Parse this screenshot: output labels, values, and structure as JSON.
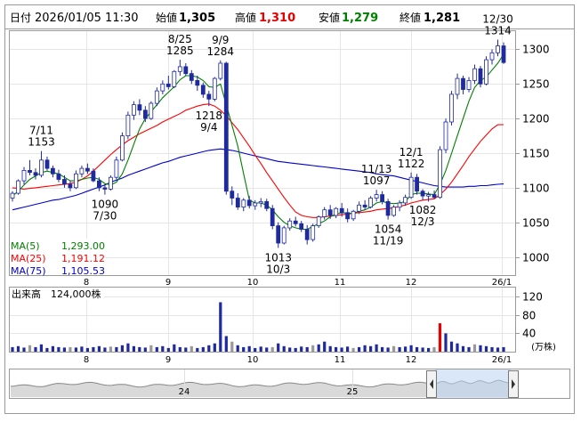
{
  "header": {
    "date_label": "日付",
    "date_value": "2026/01/05 11:30",
    "open_label": "始値",
    "open_value": "1,305",
    "high_label": "高値",
    "high_value": "1,310",
    "low_label": "安値",
    "low_value": "1,279",
    "close_label": "終値",
    "close_value": "1,281",
    "colors": {
      "high": "#e60000",
      "low": "#008000",
      "text": "#000000"
    }
  },
  "chart_data": [
    {
      "type": "candlestick",
      "y_ticks": [
        1000,
        1050,
        1100,
        1150,
        1200,
        1250,
        1300
      ],
      "x_ticks": [
        "8",
        "9",
        "10",
        "11",
        "12",
        "26/1"
      ],
      "ylim": [
        975,
        1325
      ],
      "colors": {
        "up_body": "#ffffff",
        "down_body": "#1f2a9e",
        "outline": "#1f2a9e",
        "ma5": "#008000",
        "ma25": "#ff0000",
        "ma75": "#0000cc"
      },
      "legend": [
        {
          "name": "MA(5)",
          "value": "1,293.00",
          "color": "#008000"
        },
        {
          "name": "MA(25)",
          "value": "1,191.12",
          "color": "#ff0000"
        },
        {
          "name": "MA(75)",
          "value": "1,105.53",
          "color": "#0000cc"
        }
      ],
      "annotations": [
        {
          "date": "7/11",
          "value": "1153",
          "anchor": "above"
        },
        {
          "date": "8/25",
          "value": "1285",
          "anchor": "above"
        },
        {
          "date": "9/9",
          "value": "1284",
          "anchor": "above"
        },
        {
          "date": "9/4",
          "value": "1218",
          "anchor": "below"
        },
        {
          "date": "7/30",
          "value": "1090",
          "anchor": "below"
        },
        {
          "date": "10/3",
          "value": "1013",
          "anchor": "below"
        },
        {
          "date": "11/13",
          "value": "1097",
          "anchor": "above"
        },
        {
          "date": "11/19",
          "value": "1054",
          "anchor": "below"
        },
        {
          "date": "12/1",
          "value": "1122",
          "anchor": "above"
        },
        {
          "date": "12/3",
          "value": "1082",
          "anchor": "below"
        },
        {
          "date": "12/30",
          "value": "1314",
          "anchor": "above"
        }
      ],
      "candles": [
        [
          1085,
          1095,
          1080,
          1092
        ],
        [
          1092,
          1112,
          1090,
          1110
        ],
        [
          1110,
          1130,
          1105,
          1125
        ],
        [
          1125,
          1140,
          1118,
          1122
        ],
        [
          1122,
          1128,
          1112,
          1118
        ],
        [
          1118,
          1153,
          1115,
          1140
        ],
        [
          1140,
          1145,
          1125,
          1128
        ],
        [
          1128,
          1132,
          1115,
          1120
        ],
        [
          1120,
          1126,
          1108,
          1112
        ],
        [
          1112,
          1118,
          1100,
          1105
        ],
        [
          1105,
          1110,
          1095,
          1100
        ],
        [
          1100,
          1125,
          1098,
          1120
        ],
        [
          1120,
          1132,
          1115,
          1128
        ],
        [
          1128,
          1135,
          1120,
          1124
        ],
        [
          1124,
          1128,
          1108,
          1110
        ],
        [
          1110,
          1115,
          1095,
          1100
        ],
        [
          1100,
          1105,
          1090,
          1098
        ],
        [
          1098,
          1118,
          1096,
          1115
        ],
        [
          1115,
          1145,
          1112,
          1140
        ],
        [
          1140,
          1180,
          1138,
          1175
        ],
        [
          1175,
          1210,
          1170,
          1205
        ],
        [
          1205,
          1225,
          1198,
          1220
        ],
        [
          1220,
          1228,
          1205,
          1212
        ],
        [
          1212,
          1218,
          1195,
          1200
        ],
        [
          1200,
          1225,
          1198,
          1222
        ],
        [
          1222,
          1245,
          1218,
          1240
        ],
        [
          1240,
          1255,
          1235,
          1250
        ],
        [
          1250,
          1262,
          1242,
          1246
        ],
        [
          1246,
          1270,
          1244,
          1268
        ],
        [
          1268,
          1285,
          1262,
          1275
        ],
        [
          1275,
          1280,
          1262,
          1265
        ],
        [
          1265,
          1270,
          1250,
          1255
        ],
        [
          1255,
          1262,
          1240,
          1248
        ],
        [
          1248,
          1252,
          1230,
          1235
        ],
        [
          1235,
          1240,
          1218,
          1228
        ],
        [
          1228,
          1260,
          1225,
          1258
        ],
        [
          1258,
          1284,
          1255,
          1280
        ],
        [
          1280,
          1282,
          1090,
          1095
        ],
        [
          1095,
          1102,
          1075,
          1085
        ],
        [
          1085,
          1092,
          1068,
          1072
        ],
        [
          1072,
          1085,
          1066,
          1082
        ],
        [
          1082,
          1088,
          1070,
          1074
        ],
        [
          1074,
          1082,
          1068,
          1078
        ],
        [
          1078,
          1085,
          1072,
          1080
        ],
        [
          1080,
          1084,
          1066,
          1070
        ],
        [
          1070,
          1075,
          1040,
          1045
        ],
        [
          1045,
          1050,
          1013,
          1020
        ],
        [
          1020,
          1045,
          1018,
          1042
        ],
        [
          1042,
          1056,
          1038,
          1052
        ],
        [
          1052,
          1058,
          1044,
          1048
        ],
        [
          1048,
          1052,
          1036,
          1040
        ],
        [
          1040,
          1046,
          1018,
          1025
        ],
        [
          1025,
          1048,
          1022,
          1045
        ],
        [
          1045,
          1060,
          1042,
          1058
        ],
        [
          1058,
          1072,
          1054,
          1068
        ],
        [
          1068,
          1075,
          1055,
          1060
        ],
        [
          1060,
          1072,
          1056,
          1070
        ],
        [
          1070,
          1078,
          1058,
          1064
        ],
        [
          1064,
          1070,
          1050,
          1055
        ],
        [
          1055,
          1068,
          1052,
          1066
        ],
        [
          1066,
          1080,
          1062,
          1075
        ],
        [
          1075,
          1082,
          1068,
          1072
        ],
        [
          1072,
          1088,
          1070,
          1085
        ],
        [
          1085,
          1097,
          1080,
          1090
        ],
        [
          1090,
          1095,
          1076,
          1080
        ],
        [
          1080,
          1084,
          1054,
          1060
        ],
        [
          1060,
          1075,
          1058,
          1072
        ],
        [
          1072,
          1082,
          1066,
          1078
        ],
        [
          1078,
          1090,
          1074,
          1086
        ],
        [
          1086,
          1122,
          1084,
          1115
        ],
        [
          1115,
          1120,
          1090,
          1095
        ],
        [
          1095,
          1098,
          1082,
          1088
        ],
        [
          1088,
          1094,
          1080,
          1090
        ],
        [
          1090,
          1096,
          1084,
          1086
        ],
        [
          1086,
          1160,
          1084,
          1155
        ],
        [
          1155,
          1200,
          1150,
          1195
        ],
        [
          1195,
          1240,
          1190,
          1235
        ],
        [
          1235,
          1265,
          1228,
          1258
        ],
        [
          1258,
          1262,
          1235,
          1242
        ],
        [
          1242,
          1260,
          1238,
          1255
        ],
        [
          1255,
          1278,
          1250,
          1272
        ],
        [
          1272,
          1276,
          1245,
          1250
        ],
        [
          1250,
          1290,
          1248,
          1285
        ],
        [
          1285,
          1300,
          1278,
          1295
        ],
        [
          1295,
          1314,
          1290,
          1305
        ],
        [
          1305,
          1310,
          1279,
          1281
        ]
      ],
      "ma5": [
        1088,
        1095,
        1104,
        1112,
        1117,
        1122,
        1124,
        1122,
        1120,
        1115,
        1110,
        1110,
        1112,
        1114,
        1115,
        1112,
        1106,
        1104,
        1108,
        1120,
        1140,
        1163,
        1185,
        1200,
        1210,
        1220,
        1230,
        1238,
        1246,
        1256,
        1262,
        1262,
        1260,
        1255,
        1246,
        1245,
        1250,
        1220,
        1190,
        1160,
        1120,
        1082,
        1078,
        1078,
        1075,
        1068,
        1058,
        1050,
        1045,
        1042,
        1040,
        1040,
        1044,
        1048,
        1052,
        1058,
        1062,
        1064,
        1063,
        1063,
        1066,
        1068,
        1072,
        1078,
        1080,
        1078,
        1077,
        1078,
        1080,
        1090,
        1092,
        1092,
        1091,
        1090,
        1105,
        1125,
        1150,
        1175,
        1200,
        1225,
        1245,
        1255,
        1260,
        1270,
        1280,
        1293
      ],
      "ma25": [
        1100,
        1099,
        1098,
        1099,
        1100,
        1101,
        1102,
        1103,
        1104,
        1105,
        1106,
        1108,
        1112,
        1117,
        1124,
        1132,
        1140,
        1148,
        1155,
        1162,
        1168,
        1173,
        1178,
        1182,
        1186,
        1190,
        1195,
        1199,
        1203,
        1207,
        1212,
        1215,
        1218,
        1220,
        1221,
        1218,
        1212,
        1204,
        1194,
        1184,
        1172,
        1160,
        1147,
        1135,
        1122,
        1110,
        1098,
        1086,
        1075,
        1065,
        1060,
        1058,
        1057,
        1057,
        1058,
        1059,
        1060,
        1061,
        1062,
        1063,
        1064,
        1065,
        1066,
        1068,
        1069,
        1070,
        1071,
        1073,
        1075,
        1078,
        1080,
        1082,
        1083,
        1084,
        1090,
        1098,
        1108,
        1120,
        1132,
        1145,
        1156,
        1167,
        1176,
        1185,
        1191,
        1191.12
      ],
      "ma75": [
        1068,
        1070,
        1072,
        1074,
        1076,
        1078,
        1080,
        1082,
        1083,
        1085,
        1087,
        1089,
        1092,
        1095,
        1098,
        1101,
        1104,
        1108,
        1111,
        1114,
        1118,
        1121,
        1124,
        1127,
        1130,
        1133,
        1136,
        1138,
        1141,
        1144,
        1146,
        1148,
        1150,
        1152,
        1154,
        1155,
        1156,
        1155,
        1154,
        1152,
        1150,
        1148,
        1146,
        1144,
        1142,
        1140,
        1138,
        1137,
        1136,
        1135,
        1134,
        1133,
        1132,
        1131,
        1130,
        1129,
        1128,
        1127,
        1126,
        1125,
        1124,
        1123,
        1122,
        1120,
        1119,
        1118,
        1117,
        1115,
        1113,
        1111,
        1109,
        1107,
        1105,
        1103,
        1102,
        1101,
        1101,
        1101,
        1101,
        1102,
        1102,
        1103,
        1103,
        1104,
        1105,
        1105.53
      ]
    },
    {
      "type": "bar",
      "title": "出来高",
      "value_text": "124,000株",
      "unit": "(万株)",
      "y_ticks": [
        40,
        80,
        120
      ],
      "ylim": [
        0,
        140
      ],
      "x_ticks": [
        "8",
        "9",
        "10",
        "11",
        "12",
        "26/1"
      ],
      "colors": {
        "normal": "#1f2a9e",
        "neutral": "#999999",
        "highlight": "#e60000"
      },
      "values": [
        10,
        12,
        9,
        14,
        10,
        16,
        8,
        12,
        10,
        9,
        10,
        9,
        11,
        8,
        10,
        12,
        9,
        11,
        10,
        14,
        18,
        12,
        10,
        9,
        14,
        10,
        12,
        8,
        16,
        10,
        9,
        12,
        8,
        10,
        14,
        18,
        108,
        34,
        22,
        14,
        10,
        12,
        8,
        11,
        9,
        10,
        18,
        12,
        9,
        8,
        11,
        10,
        14,
        16,
        22,
        12,
        10,
        9,
        11,
        8,
        10,
        14,
        12,
        16,
        10,
        9,
        12,
        10,
        11,
        14,
        10,
        9,
        8,
        10,
        62,
        40,
        22,
        18,
        12,
        10,
        16,
        14,
        12,
        10,
        9,
        10
      ]
    },
    {
      "type": "area",
      "x_ticks": [
        "24",
        "25"
      ]
    }
  ]
}
